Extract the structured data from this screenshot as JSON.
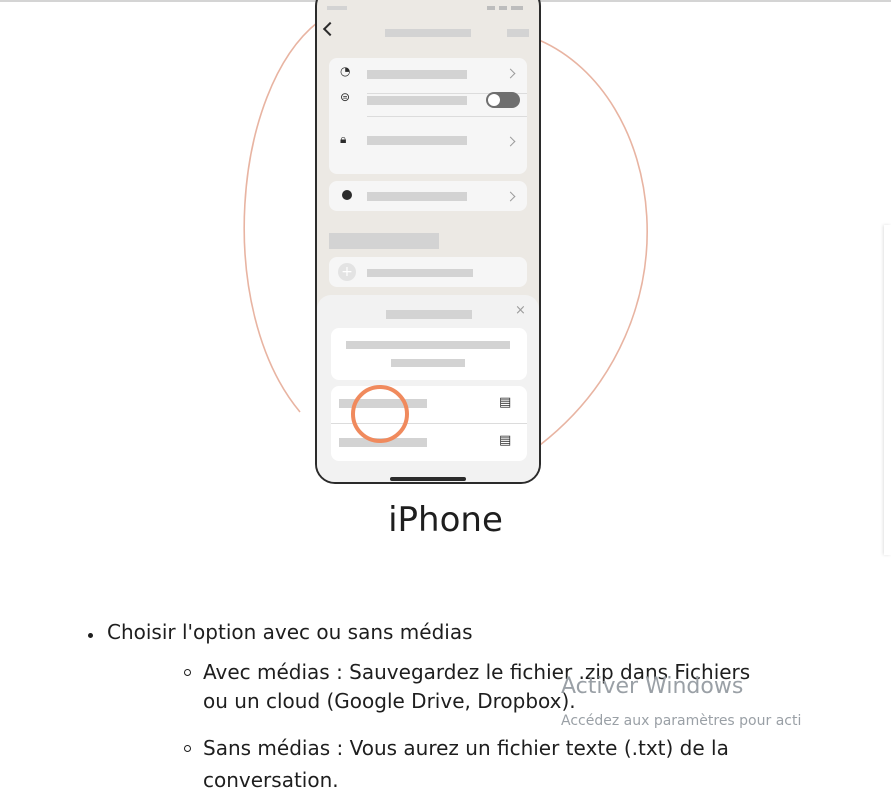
{
  "caption": "iPhone",
  "bullets": {
    "main": "Choisir l'option avec ou sans médias",
    "sub1_line1": "Avec médias : Sauvegardez le fichier .zip dans Fichiers",
    "sub1_line2": "ou un cloud (Google Drive, Dropbox).",
    "sub2_line1": "Sans médias : Vous aurez un fichier texte (.txt) de la",
    "sub2_line2": "conversation."
  },
  "watermark": {
    "title": "Activer Windows",
    "subtitle": "Accédez aux paramètres pour acti"
  },
  "colors": {
    "orbit": "#e8b4a2",
    "highlight_circle": "#f08a5d",
    "phone_bg": "#ece9e4"
  },
  "icons": [
    "back-chevron-icon",
    "speed-icon",
    "chat-lock-icon",
    "lock-icon",
    "profile-icon",
    "plus-icon",
    "close-icon",
    "contact-file-icon",
    "document-icon"
  ]
}
